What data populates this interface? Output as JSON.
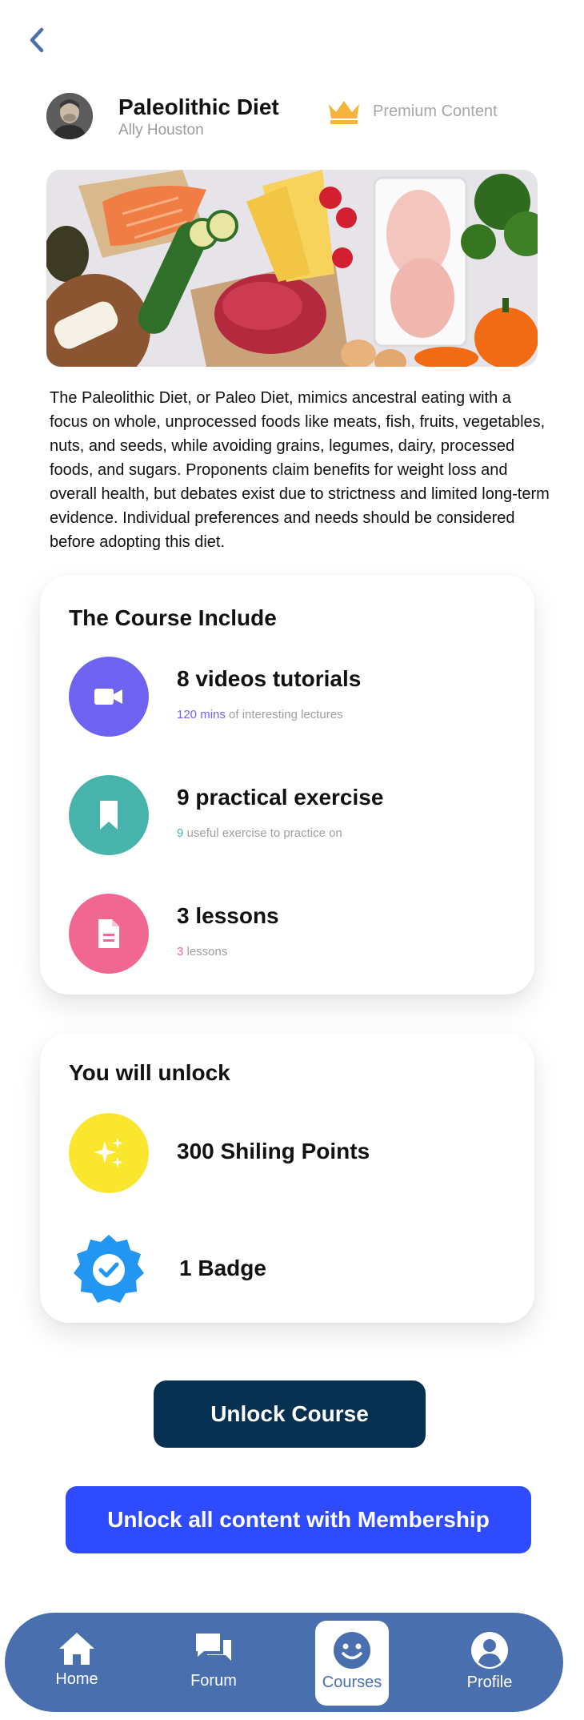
{
  "header": {
    "title": "Paleolithic Diet",
    "author": "Ally Houston",
    "premium_label": "Premium Content"
  },
  "description": "The Paleolithic Diet, or Paleo Diet, mimics ancestral eating with a focus on whole, unprocessed foods like meats, fish, fruits, vegetables, nuts, and seeds, while avoiding grains, legumes, dairy, processed foods, and sugars. Proponents claim benefits for weight loss and overall health, but debates exist due to strictness and limited long-term evidence. Individual preferences and needs should be considered before adopting this diet.",
  "course_include": {
    "title": "The Course Include",
    "items": [
      {
        "title": "8 videos tutorials",
        "highlight": "120 mins",
        "rest": " of interesting lectures",
        "icon": "video-camera-icon",
        "color": "#6e63f0"
      },
      {
        "title": "9 practical exercise",
        "highlight": "9",
        "rest": " useful exercise to practice on",
        "icon": "bookmark-icon",
        "color": "#47b3aa"
      },
      {
        "title": "3 lessons",
        "highlight": "3",
        "rest": " lessons",
        "icon": "document-icon",
        "color": "#f06891"
      }
    ]
  },
  "unlock": {
    "title": "You will unlock",
    "items": [
      {
        "title": "300 Shiling Points",
        "icon": "sparkles-icon",
        "color": "#fbe62f"
      },
      {
        "title": "1 Badge",
        "icon": "badge-check-icon",
        "color": "#2196f3"
      }
    ]
  },
  "buttons": {
    "unlock_course": "Unlock Course",
    "membership": "Unlock all content with Membership"
  },
  "nav": {
    "items": [
      {
        "label": "Home",
        "icon": "home-icon"
      },
      {
        "label": "Forum",
        "icon": "forum-icon"
      },
      {
        "label": "Courses",
        "icon": "smiley-icon",
        "active": true
      },
      {
        "label": "Profile",
        "icon": "profile-icon"
      }
    ]
  },
  "colors": {
    "back_arrow": "#4a6fae",
    "crown": "#f5b53b",
    "primary_button": "#05304f",
    "membership_button": "#2e4bff",
    "nav_bar": "#4a6fae"
  }
}
